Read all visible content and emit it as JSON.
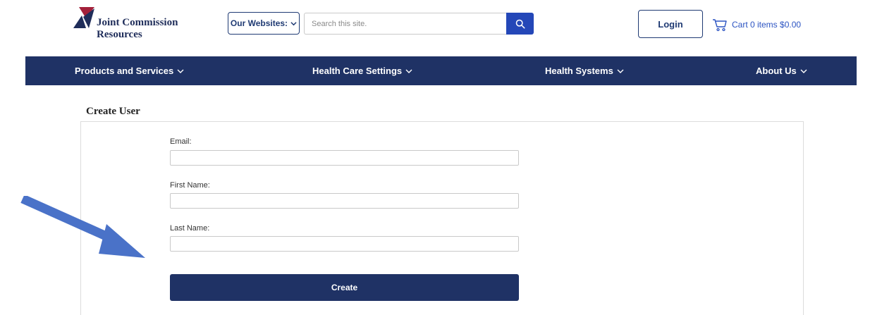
{
  "header": {
    "logo_line1": "Joint Commission",
    "logo_line2": "Resources",
    "websites_label": "Our Websites:",
    "search_placeholder": "Search this site.",
    "login_label": "Login",
    "cart_text": "Cart 0 items $0.00"
  },
  "nav": {
    "items": [
      {
        "label": "Products and Services"
      },
      {
        "label": "Health Care Settings"
      },
      {
        "label": "Health Systems"
      },
      {
        "label": "About Us"
      }
    ]
  },
  "form": {
    "title": "Create User",
    "email_label": "Email:",
    "email_value": "",
    "first_name_label": "First Name:",
    "first_name_value": "",
    "last_name_label": "Last Name:",
    "last_name_value": "",
    "submit_label": "Create"
  },
  "icons": {
    "search": "search-icon",
    "cart": "cart-icon",
    "chevron": "chevron-down-icon",
    "annotation": "arrow-icon"
  },
  "colors": {
    "brand_navy": "#1f3265",
    "search_blue": "#2447b8",
    "link_blue": "#2b53c2",
    "logo_red": "#a3203a",
    "annotation_arrow": "#4a72c8"
  }
}
